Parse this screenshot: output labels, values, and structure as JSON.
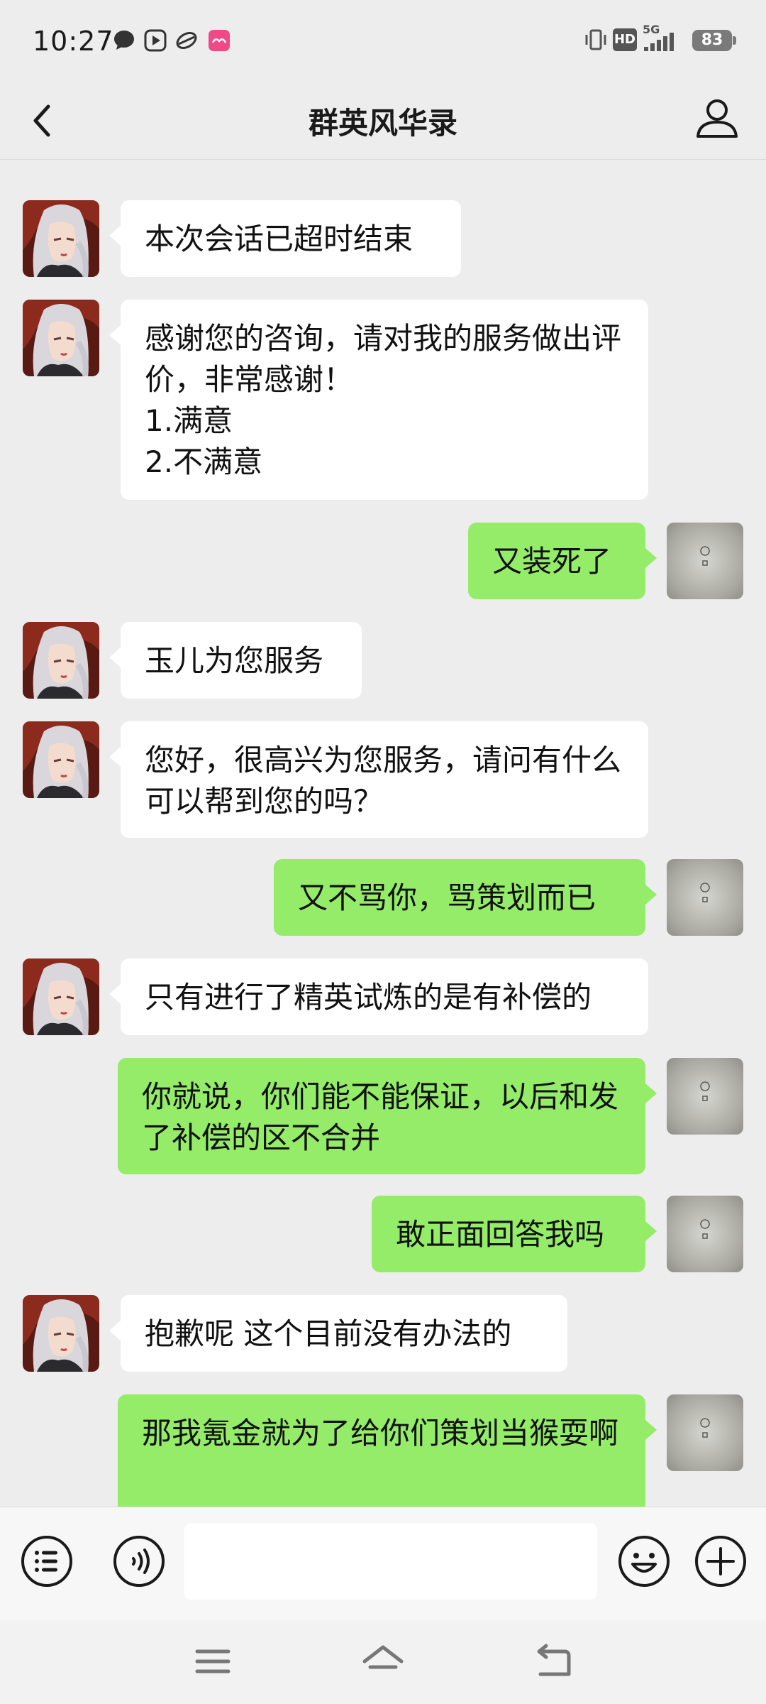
{
  "status_bar": {
    "time": "10:27",
    "hd_label": "HD",
    "network_label": "5G",
    "battery_level": "83"
  },
  "header": {
    "title": "群英风华录"
  },
  "messages": [
    {
      "side": "left",
      "text": "本次会话已超时结束"
    },
    {
      "side": "left",
      "text": "感谢您的咨询，请对我的服务做出评价，非常感谢！\n1.满意\n2.不满意"
    },
    {
      "side": "right",
      "text": "又装死了"
    },
    {
      "side": "left",
      "text": "玉儿为您服务"
    },
    {
      "side": "left",
      "text": "您好，很高兴为您服务，请问有什么可以帮到您的吗？"
    },
    {
      "side": "right",
      "text": "又不骂你，骂策划而已"
    },
    {
      "side": "left",
      "text": "只有进行了精英试炼的是有补偿的"
    },
    {
      "side": "right",
      "text": "你就说，你们能不能保证，以后和发了补偿的区不合并"
    },
    {
      "side": "right",
      "text": "敢正面回答我吗"
    },
    {
      "side": "left",
      "text": "抱歉呢 这个目前没有办法的"
    },
    {
      "side": "right",
      "text": "那我氪金就为了给你们策划当猴耍啊"
    }
  ],
  "input": {
    "value": "",
    "placeholder": ""
  },
  "colors": {
    "background": "#ededed",
    "bubble_self": "#95ec69",
    "bubble_other": "#ffffff"
  }
}
